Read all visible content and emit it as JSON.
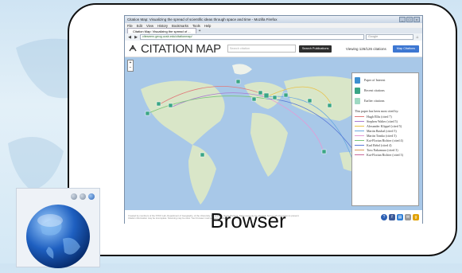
{
  "browser": {
    "window_title": "Citation Map: Visualizing the spread of scientific ideas through space and time - Mozilla Firefox",
    "menu": [
      "File",
      "Edit",
      "View",
      "History",
      "Bookmarks",
      "Tools",
      "Help"
    ],
    "tab_label": "Citation Map: Visualizing the spread of ...",
    "tab_add": "+",
    "url": "citeseerx.geog.ucsb.edu/citationmap/",
    "search_placeholder": "Google",
    "back": "◀",
    "forward": "▶",
    "home": "⌂"
  },
  "app": {
    "logo": "CITATION MAP",
    "search_placeholder": "Search citation",
    "search_button": "Search Publications",
    "viewing": "Viewing 126/126 citations",
    "map_button": "Map Citations",
    "zoom_in": "+",
    "zoom_out": "−"
  },
  "legend": {
    "paper_of_interest": "Paper of Interest",
    "recent_citations": "Recent citations",
    "earlier_citations": "Earlier citations",
    "cited_by_heading": "This paper has been most cited by:",
    "authors": [
      {
        "name": "Hugh Ellis (cited 7)",
        "color": "#e07a7a"
      },
      {
        "name": "Stephen Walter (cited 5)",
        "color": "#a97bd1"
      },
      {
        "name": "Alexander Klippel (cited 5)",
        "color": "#e8c24a"
      },
      {
        "name": "Martin Raubal (cited 5)",
        "color": "#6aa8e0"
      },
      {
        "name": "Martin Tomko (cited 5)",
        "color": "#e39bd6"
      },
      {
        "name": "Kai-Florian Richter (cited 4)",
        "color": "#7ac47a"
      },
      {
        "name": "Karl Rehrl (cited 4)",
        "color": "#5a7ad6"
      },
      {
        "name": "Toru Nakamura (cited 3)",
        "color": "#d99a5a"
      },
      {
        "name": "Kai-Florian Richter (cited 3)",
        "color": "#c86a9a"
      }
    ]
  },
  "footer": {
    "text": "Created by members of the STKO Lab, Department of Geography, of the University of California, Santa Barbara. Data used may be accurate but not all information is present. Citation information may be incomplete. Scanning may be slow. Your browser must support JavaScript."
  },
  "caption": "Browser"
}
